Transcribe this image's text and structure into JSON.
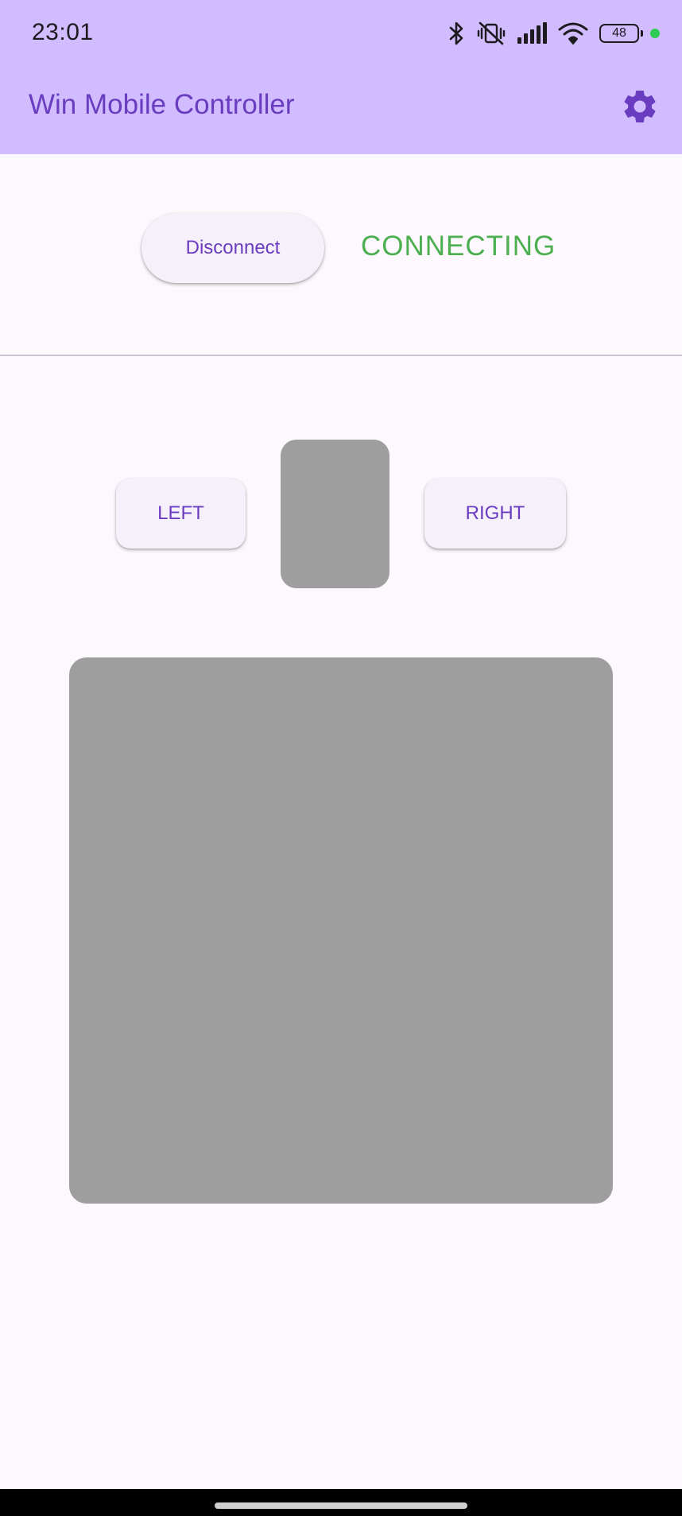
{
  "status_bar": {
    "time": "23:01",
    "battery_level": "48",
    "icons": [
      "bluetooth-icon",
      "vibrate-muted-icon",
      "cellular-signal-icon",
      "wifi-icon",
      "battery-icon",
      "privacy-indicator-dot"
    ]
  },
  "app_bar": {
    "title": "Win Mobile Controller",
    "settings_icon": "gear-icon"
  },
  "connection": {
    "disconnect_label": "Disconnect",
    "status": "CONNECTING"
  },
  "mouse_buttons": {
    "left_label": "LEFT",
    "right_label": "RIGHT"
  },
  "colors": {
    "app_bar_background": "#d0bcff",
    "primary": "#6a3dc0",
    "status_connecting": "#4caf50",
    "pad_surface": "#9e9e9e",
    "page_background": "#fdf8fd"
  }
}
